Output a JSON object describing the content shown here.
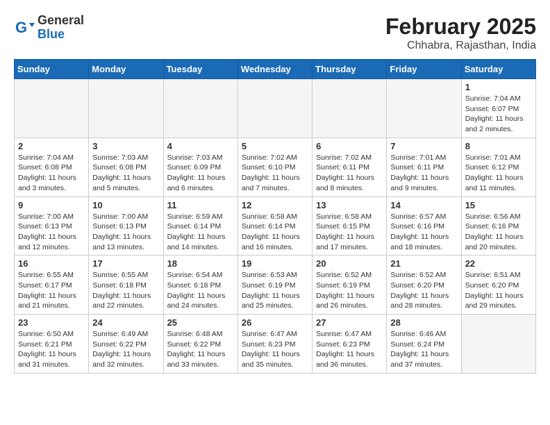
{
  "header": {
    "logo_general": "General",
    "logo_blue": "Blue",
    "month": "February 2025",
    "location": "Chhabra, Rajasthan, India"
  },
  "weekdays": [
    "Sunday",
    "Monday",
    "Tuesday",
    "Wednesday",
    "Thursday",
    "Friday",
    "Saturday"
  ],
  "weeks": [
    [
      {
        "day": "",
        "info": ""
      },
      {
        "day": "",
        "info": ""
      },
      {
        "day": "",
        "info": ""
      },
      {
        "day": "",
        "info": ""
      },
      {
        "day": "",
        "info": ""
      },
      {
        "day": "",
        "info": ""
      },
      {
        "day": "1",
        "info": "Sunrise: 7:04 AM\nSunset: 6:07 PM\nDaylight: 11 hours\nand 2 minutes."
      }
    ],
    [
      {
        "day": "2",
        "info": "Sunrise: 7:04 AM\nSunset: 6:08 PM\nDaylight: 11 hours\nand 3 minutes."
      },
      {
        "day": "3",
        "info": "Sunrise: 7:03 AM\nSunset: 6:08 PM\nDaylight: 11 hours\nand 5 minutes."
      },
      {
        "day": "4",
        "info": "Sunrise: 7:03 AM\nSunset: 6:09 PM\nDaylight: 11 hours\nand 6 minutes."
      },
      {
        "day": "5",
        "info": "Sunrise: 7:02 AM\nSunset: 6:10 PM\nDaylight: 11 hours\nand 7 minutes."
      },
      {
        "day": "6",
        "info": "Sunrise: 7:02 AM\nSunset: 6:11 PM\nDaylight: 11 hours\nand 8 minutes."
      },
      {
        "day": "7",
        "info": "Sunrise: 7:01 AM\nSunset: 6:11 PM\nDaylight: 11 hours\nand 9 minutes."
      },
      {
        "day": "8",
        "info": "Sunrise: 7:01 AM\nSunset: 6:12 PM\nDaylight: 11 hours\nand 11 minutes."
      }
    ],
    [
      {
        "day": "9",
        "info": "Sunrise: 7:00 AM\nSunset: 6:13 PM\nDaylight: 11 hours\nand 12 minutes."
      },
      {
        "day": "10",
        "info": "Sunrise: 7:00 AM\nSunset: 6:13 PM\nDaylight: 11 hours\nand 13 minutes."
      },
      {
        "day": "11",
        "info": "Sunrise: 6:59 AM\nSunset: 6:14 PM\nDaylight: 11 hours\nand 14 minutes."
      },
      {
        "day": "12",
        "info": "Sunrise: 6:58 AM\nSunset: 6:14 PM\nDaylight: 11 hours\nand 16 minutes."
      },
      {
        "day": "13",
        "info": "Sunrise: 6:58 AM\nSunset: 6:15 PM\nDaylight: 11 hours\nand 17 minutes."
      },
      {
        "day": "14",
        "info": "Sunrise: 6:57 AM\nSunset: 6:16 PM\nDaylight: 11 hours\nand 18 minutes."
      },
      {
        "day": "15",
        "info": "Sunrise: 6:56 AM\nSunset: 6:16 PM\nDaylight: 11 hours\nand 20 minutes."
      }
    ],
    [
      {
        "day": "16",
        "info": "Sunrise: 6:55 AM\nSunset: 6:17 PM\nDaylight: 11 hours\nand 21 minutes."
      },
      {
        "day": "17",
        "info": "Sunrise: 6:55 AM\nSunset: 6:18 PM\nDaylight: 11 hours\nand 22 minutes."
      },
      {
        "day": "18",
        "info": "Sunrise: 6:54 AM\nSunset: 6:18 PM\nDaylight: 11 hours\nand 24 minutes."
      },
      {
        "day": "19",
        "info": "Sunrise: 6:53 AM\nSunset: 6:19 PM\nDaylight: 11 hours\nand 25 minutes."
      },
      {
        "day": "20",
        "info": "Sunrise: 6:52 AM\nSunset: 6:19 PM\nDaylight: 11 hours\nand 26 minutes."
      },
      {
        "day": "21",
        "info": "Sunrise: 6:52 AM\nSunset: 6:20 PM\nDaylight: 11 hours\nand 28 minutes."
      },
      {
        "day": "22",
        "info": "Sunrise: 6:51 AM\nSunset: 6:20 PM\nDaylight: 11 hours\nand 29 minutes."
      }
    ],
    [
      {
        "day": "23",
        "info": "Sunrise: 6:50 AM\nSunset: 6:21 PM\nDaylight: 11 hours\nand 31 minutes."
      },
      {
        "day": "24",
        "info": "Sunrise: 6:49 AM\nSunset: 6:22 PM\nDaylight: 11 hours\nand 32 minutes."
      },
      {
        "day": "25",
        "info": "Sunrise: 6:48 AM\nSunset: 6:22 PM\nDaylight: 11 hours\nand 33 minutes."
      },
      {
        "day": "26",
        "info": "Sunrise: 6:47 AM\nSunset: 6:23 PM\nDaylight: 11 hours\nand 35 minutes."
      },
      {
        "day": "27",
        "info": "Sunrise: 6:47 AM\nSunset: 6:23 PM\nDaylight: 11 hours\nand 36 minutes."
      },
      {
        "day": "28",
        "info": "Sunrise: 6:46 AM\nSunset: 6:24 PM\nDaylight: 11 hours\nand 37 minutes."
      },
      {
        "day": "",
        "info": ""
      }
    ]
  ]
}
